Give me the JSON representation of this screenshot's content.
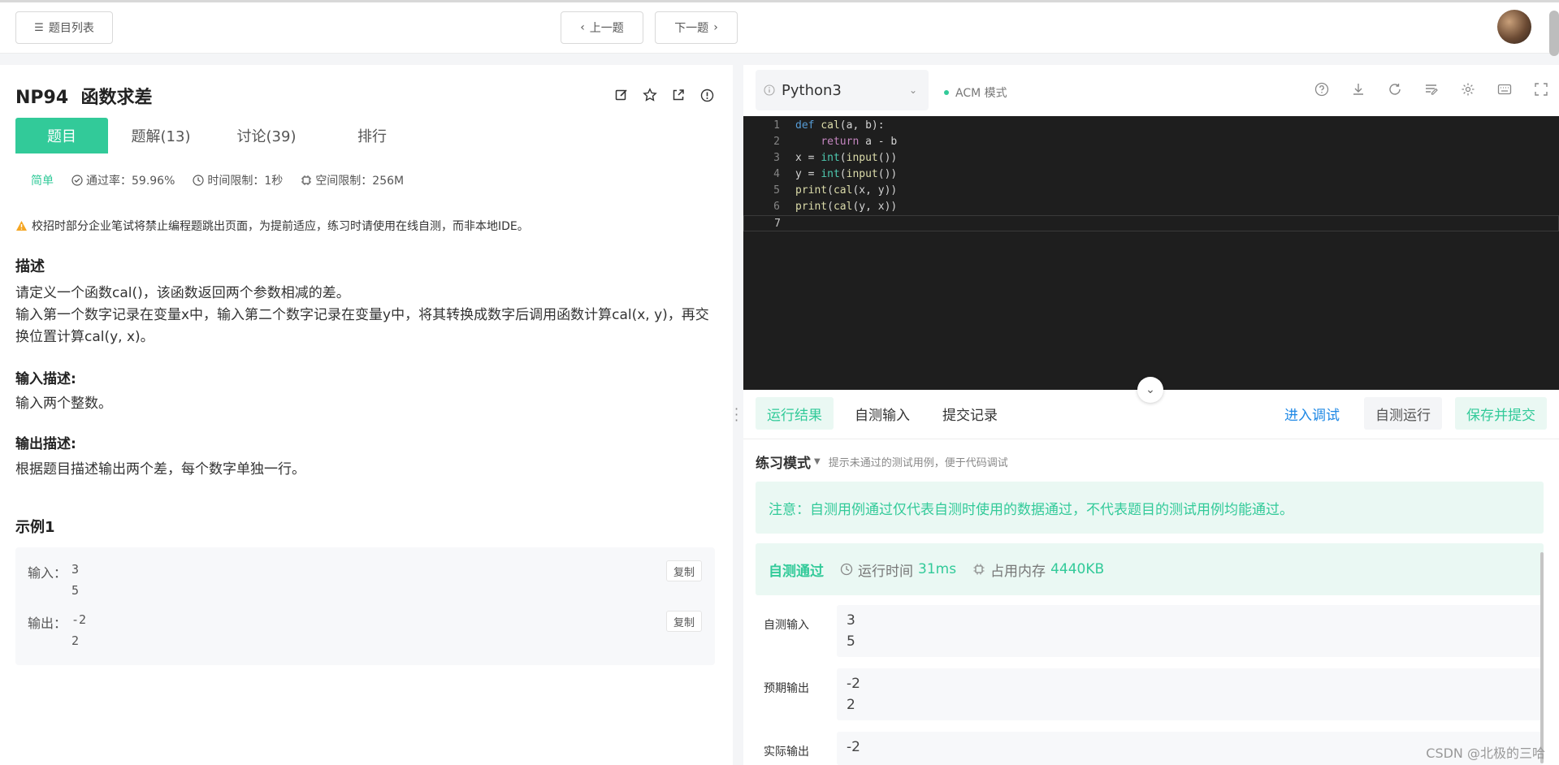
{
  "topbar": {
    "problem_list_label": "题目列表",
    "prev_label": "上一题",
    "next_label": "下一题"
  },
  "problem": {
    "id": "NP94",
    "title": "函数求差",
    "tabs": [
      {
        "label": "题目"
      },
      {
        "label": "题解(13)"
      },
      {
        "label": "讨论(39)"
      },
      {
        "label": "排行"
      }
    ],
    "difficulty": "简单",
    "pass_rate": "通过率：59.96%",
    "time_limit": "时间限制：1秒",
    "memory_limit": "空间限制：256M",
    "warning": "校招时部分企业笔试将禁止编程题跳出页面，为提前适应，练习时请使用在线自测，而非本地IDE。",
    "desc_heading": "描述",
    "desc_line1": "请定义一个函数cal()，该函数返回两个参数相减的差。",
    "desc_line2": "输入第一个数字记录在变量x中，输入第二个数字记录在变量y中，将其转换成数字后调用函数计算cal(x, y)，再交换位置计算cal(y, x)。",
    "input_heading": "输入描述:",
    "input_desc": "输入两个整数。",
    "output_heading": "输出描述:",
    "output_desc": "根据题目描述输出两个差，每个数字单独一行。",
    "example_heading": "示例1",
    "example_input_label": "输入：",
    "example_input": [
      "3",
      "5"
    ],
    "example_output_label": "输出：",
    "example_output": [
      "-2",
      "2"
    ],
    "copy_label": "复制"
  },
  "editor": {
    "language": "Python3",
    "mode": "ACM 模式",
    "line_numbers": [
      "1",
      "2",
      "3",
      "4",
      "5",
      "6",
      "7"
    ],
    "code_lines": [
      "def cal(a, b):",
      "    return a - b",
      "x = int(input())",
      "y = int(input())",
      "print(cal(x, y))",
      "print(cal(y, x))",
      ""
    ]
  },
  "results": {
    "tabs": [
      {
        "label": "运行结果"
      },
      {
        "label": "自测输入"
      },
      {
        "label": "提交记录"
      }
    ],
    "debug_label": "进入调试",
    "run_label": "自测运行",
    "submit_label": "保存并提交",
    "practice_mode": "练习模式",
    "practice_hint": "提示未通过的测试用例，便于代码调试",
    "notice": "注意：自测用例通过仅代表自测时使用的数据通过，不代表题目的测试用例均能通过。",
    "status": "自测通过",
    "runtime_label": "运行时间",
    "runtime_value": "31ms",
    "memory_label": "占用内存",
    "memory_value": "4440KB",
    "self_input_label": "自测输入",
    "self_input": [
      "3",
      "5"
    ],
    "expected_label": "预期输出",
    "expected": [
      "-2",
      "2"
    ],
    "actual_label": "实际输出",
    "actual": [
      "-2"
    ]
  },
  "watermark": "CSDN @北极的三哈",
  "colors": {
    "accent": "#32ca99",
    "link": "#1e88e5",
    "editor_bg": "#1e1e1e"
  }
}
